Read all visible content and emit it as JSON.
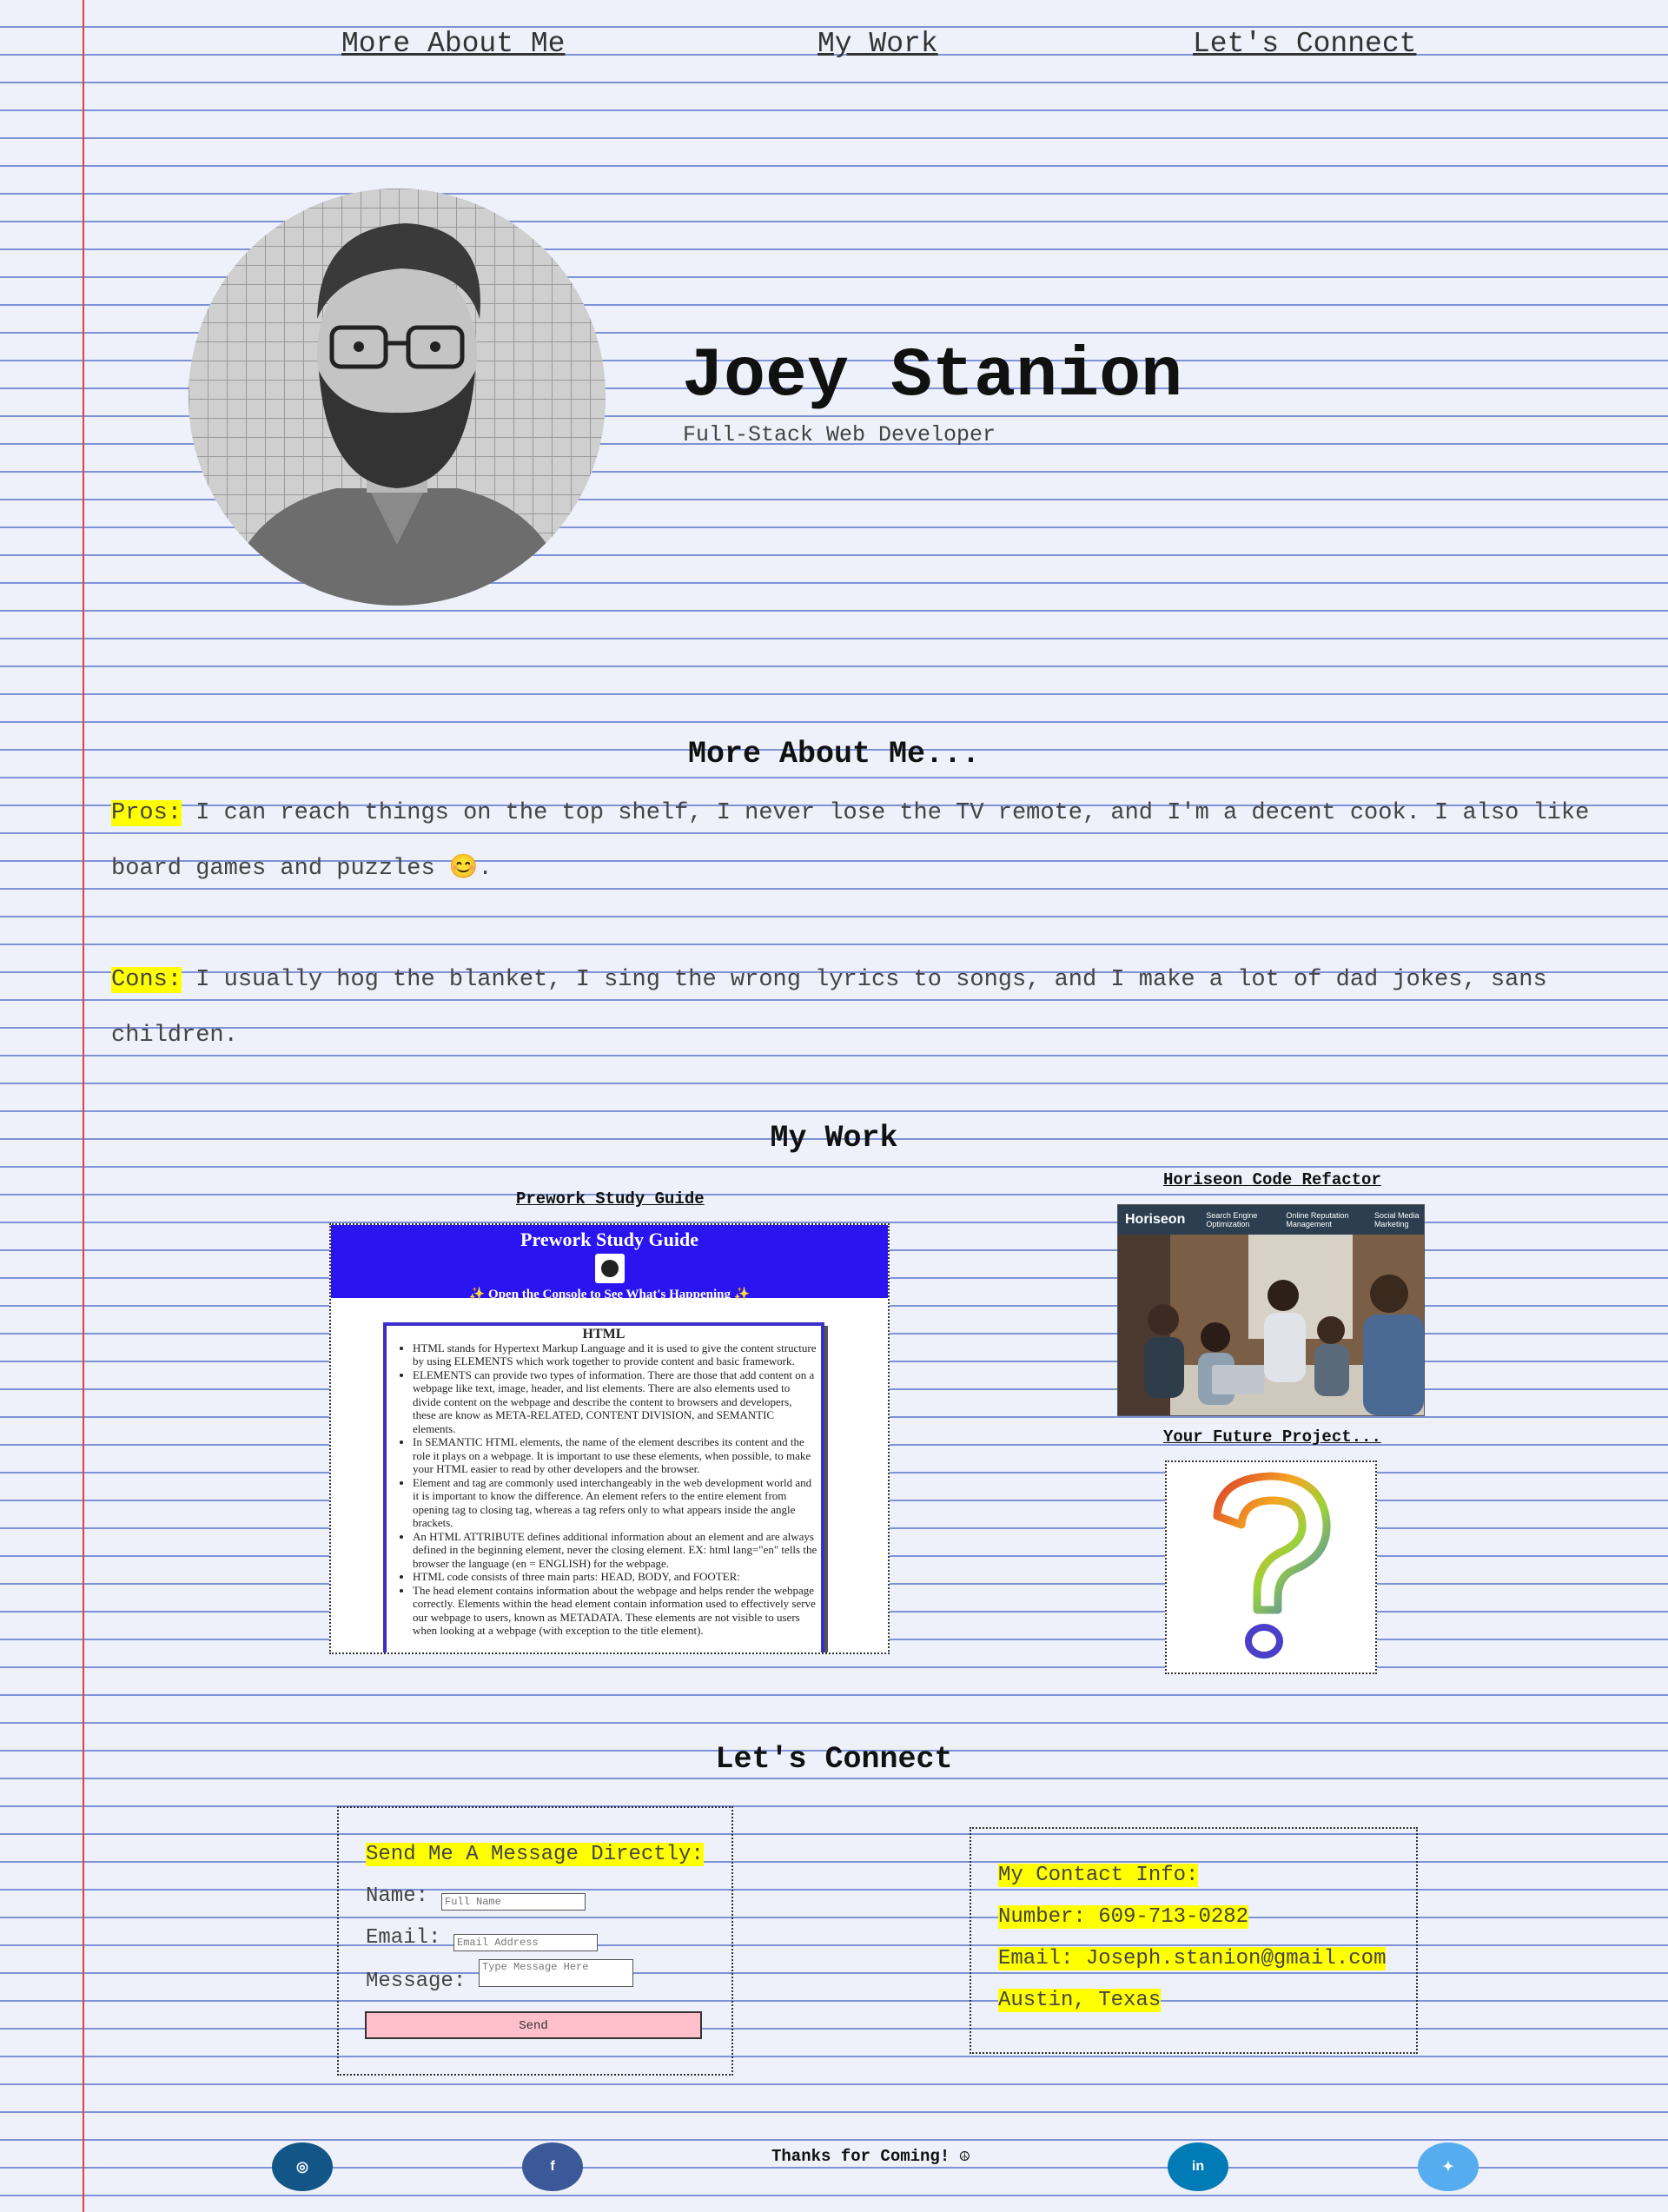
{
  "nav": {
    "items": [
      "More About Me",
      "My Work",
      "Let's Connect"
    ]
  },
  "hero": {
    "name": "Joey Stanion",
    "subtitle": "Full-Stack Web Developer"
  },
  "about": {
    "heading": "More About Me...",
    "pros_label": "Pros:",
    "pros_text": "I can reach things on the top shelf, I never lose the TV remote, and I'm a decent cook. I also like board games and puzzles 😊.",
    "cons_label": "Cons:",
    "cons_text": "I usually hog the blanket, I sing the wrong lyrics to songs, and I make a lot of dad jokes, sans children."
  },
  "work": {
    "heading": "My Work",
    "projects": [
      {
        "title": "Prework Study Guide"
      },
      {
        "title": "Horiseon Code Refactor"
      },
      {
        "title": "Your Future Project..."
      }
    ],
    "guide_preview": {
      "title": "Prework Study Guide",
      "subtitle": "✨ Open the Console to See What's Happening ✨",
      "section": "HTML",
      "bullets": [
        "HTML stands for Hypertext Markup Language and it is used to give the content structure by using ELEMENTS which work together to provide content and basic framework.",
        "ELEMENTS can provide two types of information. There are those that add content on a webpage like text, image, header, and list elements. There are also elements used to divide content on the webpage and describe the content to browsers and developers, these are know as META-RELATED, CONTENT DIVISION, and SEMANTIC elements.",
        "In SEMANTIC HTML elements, the name of the element describes its content and the role it plays on a webpage. It is important to use these elements, when possible, to make your HTML easier to read by other developers and the browser.",
        "Element and tag are commonly used interchangeably in the web development world and it is important to know the difference. An element refers to the entire element from opening tag to closing tag, whereas a tag refers only to what appears inside the angle brackets.",
        "An HTML ATTRIBUTE defines additional information about an element and are always defined in the beginning element, never the closing element. EX: html lang=\"en\" tells the browser the language (en = ENGLISH) for the webpage.",
        "HTML code consists of three main parts: HEAD, BODY, and FOOTER:",
        "The head element contains information about the webpage and helps render the webpage correctly. Elements within the head element contain information used to effectively serve our webpage to users, known as METADATA. These elements are not visible to users when looking at a webpage (with exception to the title element)."
      ]
    },
    "horiseon_preview": {
      "brand": "Horiseon",
      "menu": [
        "Search Engine Optimization",
        "Online Reputation Management",
        "Social Media Marketing"
      ]
    }
  },
  "connect": {
    "heading": "Let's Connect",
    "form": {
      "title": "Send Me A Message Directly:",
      "name_label": "Name:",
      "name_placeholder": "Full Name",
      "email_label": "Email:",
      "email_placeholder": "Email Address",
      "message_label": "Message:",
      "message_placeholder": "Type Message Here",
      "send_label": "Send"
    },
    "contact": {
      "title": "My Contact Info:",
      "number": "Number: 609-713-0282",
      "email": "Email: Joseph.stanion@gmail.com",
      "location": "Austin, Texas"
    }
  },
  "footer": {
    "text": "Thanks for Coming! ☮",
    "social": [
      {
        "name": "instagram",
        "glyph": "◎",
        "color": "#125688"
      },
      {
        "name": "facebook",
        "glyph": "f",
        "color": "#3b5998"
      },
      {
        "name": "linkedin",
        "glyph": "in",
        "color": "#007bb5"
      },
      {
        "name": "twitter",
        "glyph": "✦",
        "color": "#55acee"
      }
    ]
  }
}
